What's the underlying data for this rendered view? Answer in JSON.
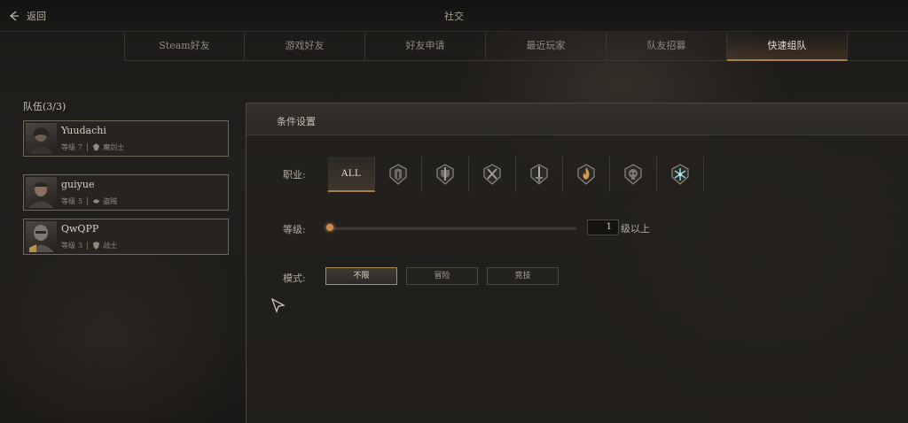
{
  "header": {
    "back_label": "返回",
    "title": "社交"
  },
  "tabs": [
    {
      "label": "Steam好友",
      "active": false
    },
    {
      "label": "游戏好友",
      "active": false
    },
    {
      "label": "好友申请",
      "active": false
    },
    {
      "label": "最近玩家",
      "active": false
    },
    {
      "label": "队友招募",
      "active": false
    },
    {
      "label": "快速组队",
      "active": true
    }
  ],
  "party": {
    "header": "队伍(3/3)",
    "members": [
      {
        "name": "Yuudachi",
        "level_label": "等级",
        "level": "7",
        "class_icon": "mage-sword-icon",
        "class": "魔剑士"
      },
      {
        "name": "guiyue",
        "level_label": "等级",
        "level": "5",
        "class_icon": "assassin-icon",
        "class": "盗贼"
      },
      {
        "name": "QwQPP",
        "level_label": "等级",
        "level": "3",
        "class_icon": "warrior-icon",
        "class": "战士"
      }
    ]
  },
  "dialog": {
    "title": "条件设置",
    "class_label": "职业:",
    "class_options": [
      {
        "icon": "all",
        "text": "ALL",
        "active": true
      },
      {
        "icon": "helmet-icon",
        "active": false
      },
      {
        "icon": "shield-sword-icon",
        "active": false
      },
      {
        "icon": "crossed-swords-icon",
        "active": false
      },
      {
        "icon": "greatsword-icon",
        "active": false
      },
      {
        "icon": "fire-icon",
        "active": false
      },
      {
        "icon": "skull-icon",
        "active": false
      },
      {
        "icon": "frost-icon",
        "active": false
      }
    ],
    "level_label": "等级:",
    "level_value": "1",
    "level_fraction": 0.0,
    "level_suffix": "级以上",
    "mode_label": "模式:",
    "modes": [
      {
        "label": "不限",
        "active": true
      },
      {
        "label": "冒险",
        "active": false
      },
      {
        "label": "竞技",
        "active": false
      }
    ]
  }
}
